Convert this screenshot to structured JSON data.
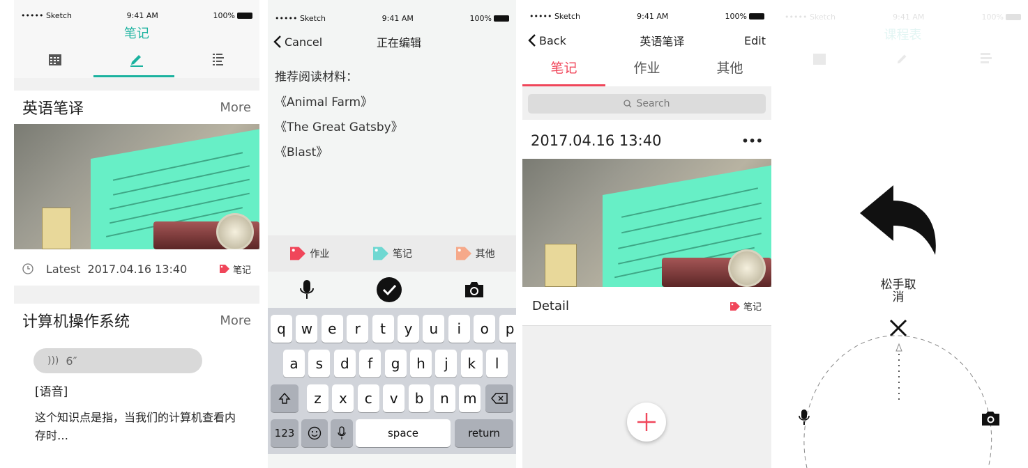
{
  "status": {
    "carrier": "••••• Sketch",
    "time": "9:41 AM",
    "battery": "100%"
  },
  "screen1": {
    "title": "笔记",
    "tab_icons": [
      "calendar-icon",
      "pencil-icon",
      "list-icon"
    ],
    "card1": {
      "heading": "英语笔译",
      "more": "More",
      "latest_label": "Latest",
      "timestamp": "2017.04.16 13:40",
      "tag": "笔记"
    },
    "card2": {
      "heading": "计算机操作系统",
      "more": "More",
      "voice_duration": "6″",
      "voice_label": "[语音]",
      "snippet_line1": "这个知识点是指，当我们的计算机查看内",
      "snippet_line2": "存时…"
    }
  },
  "screen2": {
    "cancel": "Cancel",
    "title": "正在编辑",
    "lines": [
      "推荐阅读材料：",
      "《Animal Farm》",
      "《The Great Gatsby》",
      "《Blast》"
    ],
    "tags": [
      {
        "label": "作业",
        "color": "#f0465a"
      },
      {
        "label": "笔记",
        "color": "#6fd8d2"
      },
      {
        "label": "其他",
        "color": "#f6a98a"
      }
    ],
    "keys_row1": [
      "q",
      "w",
      "e",
      "r",
      "t",
      "y",
      "u",
      "i",
      "o",
      "p"
    ],
    "keys_row2": [
      "a",
      "s",
      "d",
      "f",
      "g",
      "h",
      "j",
      "k",
      "l"
    ],
    "keys_row3": [
      "z",
      "x",
      "c",
      "v",
      "b",
      "n",
      "m"
    ],
    "key_123": "123",
    "key_space": "space",
    "key_return": "return"
  },
  "screen3": {
    "back": "Back",
    "title": "英语笔译",
    "edit": "Edit",
    "tabs": [
      "笔记",
      "作业",
      "其他"
    ],
    "search_placeholder": "Search",
    "timestamp": "2017.04.16 13:40",
    "dots": "•••",
    "detail": "Detail",
    "tag": "笔记",
    "accent": "#f0465a"
  },
  "screen4": {
    "title": "课程表",
    "hint_line1": "松手取",
    "hint_line2": "消"
  },
  "colors": {
    "teal": "#1bb29f",
    "red": "#f0465a"
  }
}
